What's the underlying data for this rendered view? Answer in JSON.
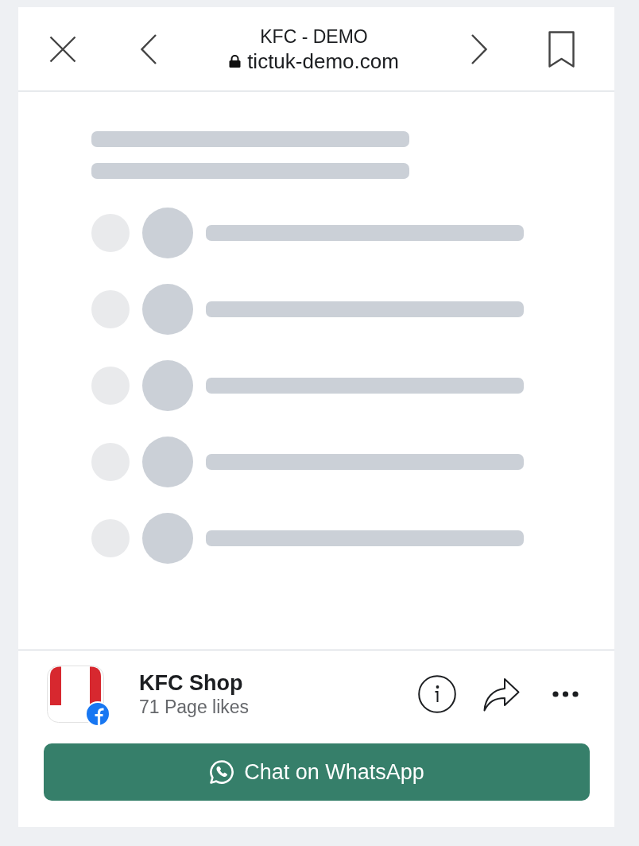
{
  "browser_bar": {
    "title": "KFC - DEMO",
    "address": "tictuk-demo.com",
    "secure": true
  },
  "page_content": {
    "loading": true
  },
  "page_info": {
    "name": "KFC Shop",
    "likes": "71 Page likes"
  },
  "action_button": {
    "label": "Chat on WhatsApp"
  }
}
